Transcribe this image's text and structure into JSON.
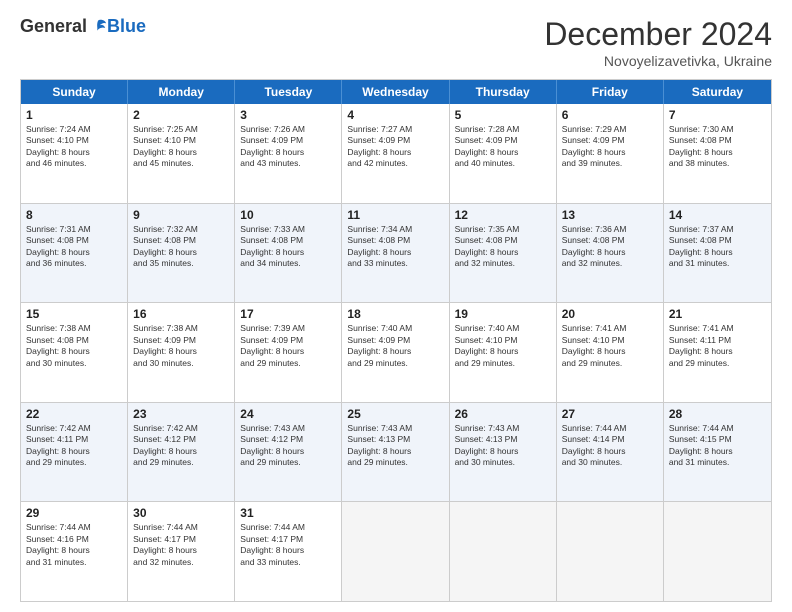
{
  "logo": {
    "general": "General",
    "blue": "Blue"
  },
  "title": {
    "month": "December 2024",
    "location": "Novoyelizavetivka, Ukraine"
  },
  "days": [
    "Sunday",
    "Monday",
    "Tuesday",
    "Wednesday",
    "Thursday",
    "Friday",
    "Saturday"
  ],
  "rows": [
    [
      {
        "day": "1",
        "lines": [
          "Sunrise: 7:24 AM",
          "Sunset: 4:10 PM",
          "Daylight: 8 hours",
          "and 46 minutes."
        ]
      },
      {
        "day": "2",
        "lines": [
          "Sunrise: 7:25 AM",
          "Sunset: 4:10 PM",
          "Daylight: 8 hours",
          "and 45 minutes."
        ]
      },
      {
        "day": "3",
        "lines": [
          "Sunrise: 7:26 AM",
          "Sunset: 4:09 PM",
          "Daylight: 8 hours",
          "and 43 minutes."
        ]
      },
      {
        "day": "4",
        "lines": [
          "Sunrise: 7:27 AM",
          "Sunset: 4:09 PM",
          "Daylight: 8 hours",
          "and 42 minutes."
        ]
      },
      {
        "day": "5",
        "lines": [
          "Sunrise: 7:28 AM",
          "Sunset: 4:09 PM",
          "Daylight: 8 hours",
          "and 40 minutes."
        ]
      },
      {
        "day": "6",
        "lines": [
          "Sunrise: 7:29 AM",
          "Sunset: 4:09 PM",
          "Daylight: 8 hours",
          "and 39 minutes."
        ]
      },
      {
        "day": "7",
        "lines": [
          "Sunrise: 7:30 AM",
          "Sunset: 4:08 PM",
          "Daylight: 8 hours",
          "and 38 minutes."
        ]
      }
    ],
    [
      {
        "day": "8",
        "lines": [
          "Sunrise: 7:31 AM",
          "Sunset: 4:08 PM",
          "Daylight: 8 hours",
          "and 36 minutes."
        ]
      },
      {
        "day": "9",
        "lines": [
          "Sunrise: 7:32 AM",
          "Sunset: 4:08 PM",
          "Daylight: 8 hours",
          "and 35 minutes."
        ]
      },
      {
        "day": "10",
        "lines": [
          "Sunrise: 7:33 AM",
          "Sunset: 4:08 PM",
          "Daylight: 8 hours",
          "and 34 minutes."
        ]
      },
      {
        "day": "11",
        "lines": [
          "Sunrise: 7:34 AM",
          "Sunset: 4:08 PM",
          "Daylight: 8 hours",
          "and 33 minutes."
        ]
      },
      {
        "day": "12",
        "lines": [
          "Sunrise: 7:35 AM",
          "Sunset: 4:08 PM",
          "Daylight: 8 hours",
          "and 32 minutes."
        ]
      },
      {
        "day": "13",
        "lines": [
          "Sunrise: 7:36 AM",
          "Sunset: 4:08 PM",
          "Daylight: 8 hours",
          "and 32 minutes."
        ]
      },
      {
        "day": "14",
        "lines": [
          "Sunrise: 7:37 AM",
          "Sunset: 4:08 PM",
          "Daylight: 8 hours",
          "and 31 minutes."
        ]
      }
    ],
    [
      {
        "day": "15",
        "lines": [
          "Sunrise: 7:38 AM",
          "Sunset: 4:08 PM",
          "Daylight: 8 hours",
          "and 30 minutes."
        ]
      },
      {
        "day": "16",
        "lines": [
          "Sunrise: 7:38 AM",
          "Sunset: 4:09 PM",
          "Daylight: 8 hours",
          "and 30 minutes."
        ]
      },
      {
        "day": "17",
        "lines": [
          "Sunrise: 7:39 AM",
          "Sunset: 4:09 PM",
          "Daylight: 8 hours",
          "and 29 minutes."
        ]
      },
      {
        "day": "18",
        "lines": [
          "Sunrise: 7:40 AM",
          "Sunset: 4:09 PM",
          "Daylight: 8 hours",
          "and 29 minutes."
        ]
      },
      {
        "day": "19",
        "lines": [
          "Sunrise: 7:40 AM",
          "Sunset: 4:10 PM",
          "Daylight: 8 hours",
          "and 29 minutes."
        ]
      },
      {
        "day": "20",
        "lines": [
          "Sunrise: 7:41 AM",
          "Sunset: 4:10 PM",
          "Daylight: 8 hours",
          "and 29 minutes."
        ]
      },
      {
        "day": "21",
        "lines": [
          "Sunrise: 7:41 AM",
          "Sunset: 4:11 PM",
          "Daylight: 8 hours",
          "and 29 minutes."
        ]
      }
    ],
    [
      {
        "day": "22",
        "lines": [
          "Sunrise: 7:42 AM",
          "Sunset: 4:11 PM",
          "Daylight: 8 hours",
          "and 29 minutes."
        ]
      },
      {
        "day": "23",
        "lines": [
          "Sunrise: 7:42 AM",
          "Sunset: 4:12 PM",
          "Daylight: 8 hours",
          "and 29 minutes."
        ]
      },
      {
        "day": "24",
        "lines": [
          "Sunrise: 7:43 AM",
          "Sunset: 4:12 PM",
          "Daylight: 8 hours",
          "and 29 minutes."
        ]
      },
      {
        "day": "25",
        "lines": [
          "Sunrise: 7:43 AM",
          "Sunset: 4:13 PM",
          "Daylight: 8 hours",
          "and 29 minutes."
        ]
      },
      {
        "day": "26",
        "lines": [
          "Sunrise: 7:43 AM",
          "Sunset: 4:13 PM",
          "Daylight: 8 hours",
          "and 30 minutes."
        ]
      },
      {
        "day": "27",
        "lines": [
          "Sunrise: 7:44 AM",
          "Sunset: 4:14 PM",
          "Daylight: 8 hours",
          "and 30 minutes."
        ]
      },
      {
        "day": "28",
        "lines": [
          "Sunrise: 7:44 AM",
          "Sunset: 4:15 PM",
          "Daylight: 8 hours",
          "and 31 minutes."
        ]
      }
    ],
    [
      {
        "day": "29",
        "lines": [
          "Sunrise: 7:44 AM",
          "Sunset: 4:16 PM",
          "Daylight: 8 hours",
          "and 31 minutes."
        ]
      },
      {
        "day": "30",
        "lines": [
          "Sunrise: 7:44 AM",
          "Sunset: 4:17 PM",
          "Daylight: 8 hours",
          "and 32 minutes."
        ]
      },
      {
        "day": "31",
        "lines": [
          "Sunrise: 7:44 AM",
          "Sunset: 4:17 PM",
          "Daylight: 8 hours",
          "and 33 minutes."
        ]
      },
      {
        "day": "",
        "lines": []
      },
      {
        "day": "",
        "lines": []
      },
      {
        "day": "",
        "lines": []
      },
      {
        "day": "",
        "lines": []
      }
    ]
  ]
}
